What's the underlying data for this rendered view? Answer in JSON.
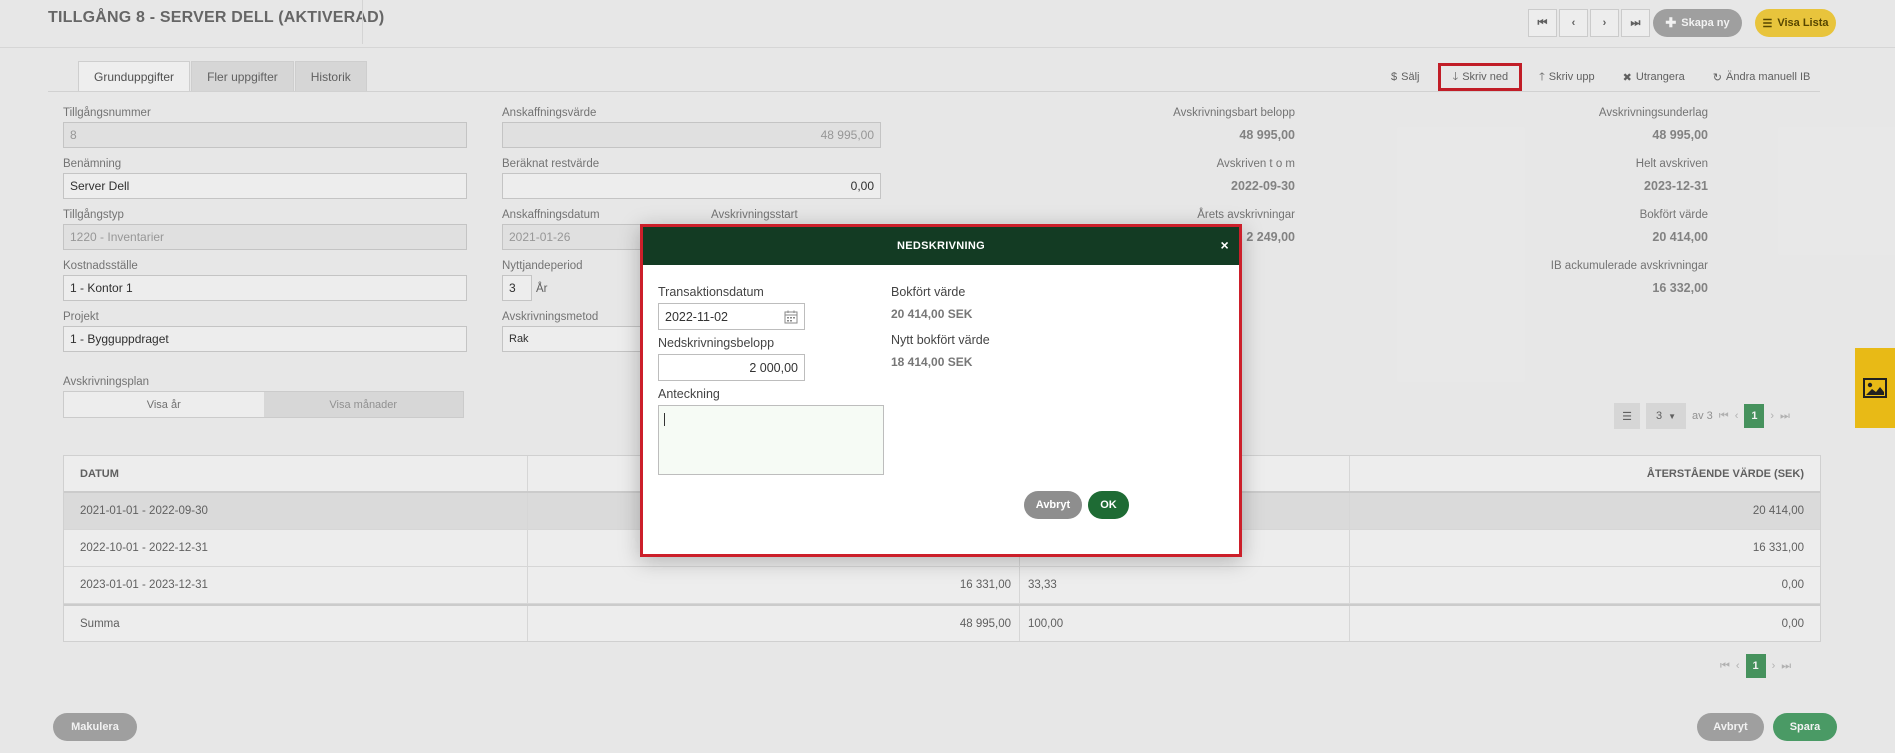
{
  "header": {
    "title": "TILLGÅNG 8 - SERVER DELL (AKTIVERAD)",
    "nav": {
      "first": "⏮",
      "prev": "‹",
      "next": "›",
      "last": "⏭"
    },
    "create_new": "Skapa ny",
    "show_list": "Visa Lista"
  },
  "tabs": [
    "Grunduppgifter",
    "Fler uppgifter",
    "Historik"
  ],
  "actions": {
    "sell": "Sälj",
    "write_down": "Skriv ned",
    "write_up": "Skriv upp",
    "scrap": "Utrangera",
    "change_manual_ib": "Ändra manuell IB"
  },
  "form": {
    "asset_number": {
      "label": "Tillgångsnummer",
      "value": "8"
    },
    "name": {
      "label": "Benämning",
      "value": "Server Dell"
    },
    "asset_type": {
      "label": "Tillgångstyp",
      "value": "1220 - Inventarier"
    },
    "cost_center": {
      "label": "Kostnadsställe",
      "value": "1 - Kontor 1"
    },
    "project": {
      "label": "Projekt",
      "value": "1 - Bygguppdraget"
    },
    "acquisition_value": {
      "label": "Anskaffningsvärde",
      "value": "48 995,00"
    },
    "residual_value": {
      "label": "Beräknat restvärde",
      "value": "0,00"
    },
    "acquisition_date": {
      "label": "Anskaffningsdatum",
      "value": "2021-01-26"
    },
    "depreciation_start": {
      "label": "Avskrivningsstart"
    },
    "useful_life": {
      "label": "Nyttjandeperiod",
      "value": "3",
      "unit": "År"
    },
    "depreciation_method": {
      "label": "Avskrivningsmetod",
      "value": "Rak"
    }
  },
  "info": {
    "depreciable_amount": {
      "label": "Avskrivningsbart belopp",
      "value": "48 995,00"
    },
    "depreciation_basis": {
      "label": "Avskrivningsunderlag",
      "value": "48 995,00"
    },
    "depreciated_until": {
      "label": "Avskriven t o m",
      "value": "2022-09-30"
    },
    "fully_depreciated": {
      "label": "Helt avskriven",
      "value": "2023-12-31"
    },
    "year_depreciation": {
      "label": "Årets avskrivningar",
      "value": "2 249,00"
    },
    "book_value": {
      "label": "Bokfört värde",
      "value": "20 414,00"
    },
    "ib_accumulated": {
      "label": "IB ackumulerade avskrivningar",
      "value": "16 332,00"
    }
  },
  "plan": {
    "label": "Avskrivningsplan",
    "show_years": "Visa år",
    "show_months": "Visa månader"
  },
  "pager_top": {
    "per_page": "3",
    "of_text": "av 3",
    "page": "1"
  },
  "pager_bottom": {
    "page": "1"
  },
  "table": {
    "headers": [
      "DATUM",
      "",
      "",
      "ÅTERSTÅENDE VÄRDE (SEK)"
    ],
    "rows": [
      [
        "2021-01-01 - 2022-09-30",
        "",
        "",
        "20 414,00"
      ],
      [
        "2022-10-01 - 2022-12-31",
        "",
        "",
        "16 331,00"
      ],
      [
        "2023-01-01 - 2023-12-31",
        "16 331,00",
        "33,33",
        "0,00"
      ]
    ],
    "sum": [
      "Summa",
      "48 995,00",
      "100,00",
      "0,00"
    ]
  },
  "footer": {
    "void": "Makulera",
    "cancel": "Avbryt",
    "save": "Spara"
  },
  "modal": {
    "title": "NEDSKRIVNING",
    "close": "×",
    "transaction_date": {
      "label": "Transaktionsdatum",
      "value": "2022-11-02"
    },
    "amount": {
      "label": "Nedskrivningsbelopp",
      "value": "2 000,00"
    },
    "note": {
      "label": "Anteckning",
      "value": ""
    },
    "book_value": {
      "label": "Bokfört värde",
      "value": "20 414,00 SEK"
    },
    "new_book_value": {
      "label": "Nytt bokfört värde",
      "value": "18 414,00 SEK"
    },
    "cancel": "Avbryt",
    "ok": "OK"
  },
  "colors": {
    "modal_header": "#133b23",
    "highlight": "#cc1f2a",
    "ok_button": "#1e6b34",
    "yellow": "#f5cf40",
    "green": "#4fa36b"
  }
}
